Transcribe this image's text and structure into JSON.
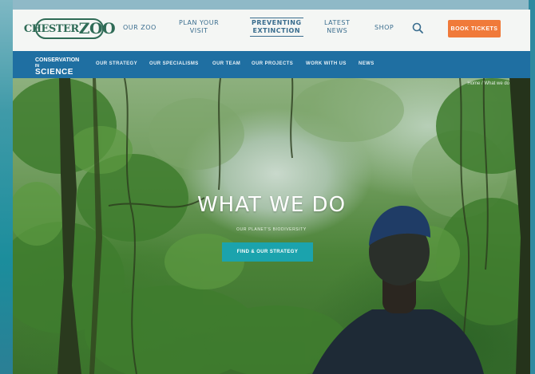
{
  "header": {
    "logo_text_a": "CHESTER",
    "logo_text_b": "ZOO",
    "nav": [
      {
        "label_1": "OUR ZOO",
        "label_2": ""
      },
      {
        "label_1": "PLAN YOUR",
        "label_2": "VISIT"
      },
      {
        "label_1": "PREVENTING",
        "label_2": "EXTINCTION"
      },
      {
        "label_1": "LATEST",
        "label_2": "NEWS"
      },
      {
        "label_1": "SHOP",
        "label_2": ""
      }
    ],
    "tickets_label": "BOOK TICKETS"
  },
  "subnav": {
    "brand_top": "CONSERVATION",
    "brand_mid": "IN",
    "brand_bottom": "SCIENCE",
    "links": [
      "OUR STRATEGY",
      "OUR SPECIALISMS",
      "OUR TEAM",
      "OUR PROJECTS",
      "WORK WITH US",
      "NEWS"
    ]
  },
  "hero": {
    "breadcrumb": "Home  /  What we do",
    "title": "WHAT WE DO",
    "subtitle": "OUR PLANET'S BIODIVERSITY",
    "cta": "FIND & OUR STRATEGY"
  },
  "colors": {
    "brand_green": "#2f6b56",
    "nav_blue": "#1f6fa2",
    "ticket_orange": "#f07a3a",
    "cta_teal": "#1ba3ad"
  }
}
